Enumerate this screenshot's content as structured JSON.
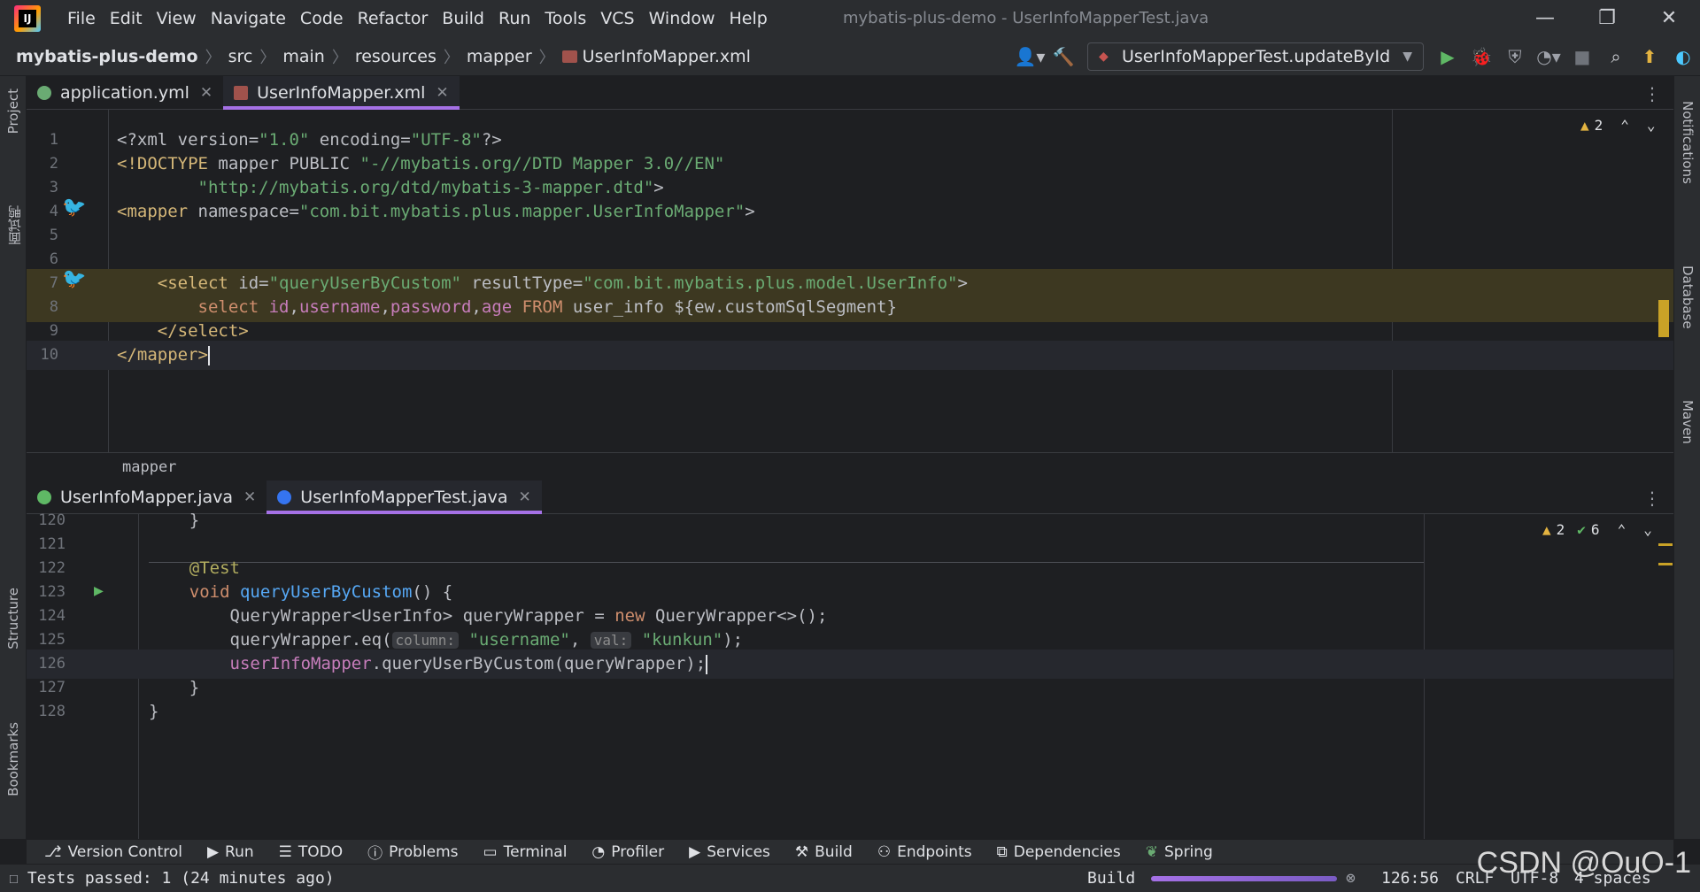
{
  "window": {
    "title": "mybatis-plus-demo - UserInfoMapperTest.java",
    "logo_text": "IJ",
    "menu": [
      "File",
      "Edit",
      "View",
      "Navigate",
      "Code",
      "Refactor",
      "Build",
      "Run",
      "Tools",
      "VCS",
      "Window",
      "Help"
    ],
    "controls": {
      "minimize": "—",
      "restore": "❐",
      "close": "✕"
    }
  },
  "breadcrumbs": [
    "mybatis-plus-demo",
    "src",
    "main",
    "resources",
    "mapper",
    "UserInfoMapper.xml"
  ],
  "run_config": {
    "label": "UserInfoMapperTest.updateById"
  },
  "top_editor": {
    "tabs": [
      {
        "label": "application.yml",
        "active": false
      },
      {
        "label": "UserInfoMapper.xml",
        "active": true
      }
    ],
    "warnings": "2",
    "breadcrumb": "mapper",
    "lines": [
      {
        "n": "1",
        "parts": [
          [
            "t-plain",
            "<?xml version="
          ],
          [
            "t-str",
            "\"1.0\""
          ],
          [
            "t-plain",
            " encoding="
          ],
          [
            "t-str",
            "\"UTF-8\""
          ],
          [
            "t-plain",
            "?>"
          ]
        ]
      },
      {
        "n": "2",
        "parts": [
          [
            "t-tag",
            "<!DOCTYPE"
          ],
          [
            "t-plain",
            " mapper PUBLIC "
          ],
          [
            "t-str",
            "\"-//mybatis.org//DTD Mapper 3.0//EN\""
          ]
        ]
      },
      {
        "n": "3",
        "parts": [
          [
            "t-str",
            "        \"http://mybatis.org/dtd/mybatis-3-mapper.dtd\""
          ],
          [
            "t-plain",
            ">"
          ]
        ]
      },
      {
        "n": "4",
        "parts": [
          [
            "t-tag",
            "<mapper"
          ],
          [
            "t-plain",
            " namespace="
          ],
          [
            "t-str",
            "\"com.bit.mybatis.plus.mapper.UserInfoMapper\""
          ],
          [
            "t-plain",
            ">"
          ]
        ]
      },
      {
        "n": "5",
        "parts": []
      },
      {
        "n": "6",
        "parts": []
      },
      {
        "n": "7",
        "parts": [
          [
            "t-tag",
            "    <select"
          ],
          [
            "t-plain",
            " id="
          ],
          [
            "t-str",
            "\"queryUserByCustom\""
          ],
          [
            "t-plain",
            " resultType="
          ],
          [
            "t-str",
            "\"com.bit.mybatis.plus.model.UserInfo\""
          ],
          [
            "t-plain",
            ">"
          ]
        ]
      },
      {
        "n": "8",
        "parts": [
          [
            "t-kw",
            "        select "
          ],
          [
            "t-fld",
            "id"
          ],
          [
            "t-plain",
            ","
          ],
          [
            "t-fld",
            "username"
          ],
          [
            "t-plain",
            ","
          ],
          [
            "t-fld",
            "password"
          ],
          [
            "t-plain",
            ","
          ],
          [
            "t-fld",
            "age"
          ],
          [
            "t-kw",
            " FROM "
          ],
          [
            "t-plain",
            "user_info ${ew.customSqlSegment}"
          ]
        ]
      },
      {
        "n": "9",
        "parts": [
          [
            "t-tag",
            "    </select>"
          ]
        ]
      },
      {
        "n": "10",
        "parts": [
          [
            "t-tag",
            "</mapper>"
          ]
        ]
      }
    ]
  },
  "bottom_editor": {
    "tabs": [
      {
        "label": "UserInfoMapper.java",
        "active": false
      },
      {
        "label": "UserInfoMapperTest.java",
        "active": true
      }
    ],
    "warnings": "2",
    "checks": "6",
    "lines": [
      {
        "n": "120",
        "parts": [
          [
            "t-plain",
            "    }"
          ]
        ]
      },
      {
        "n": "121",
        "parts": []
      },
      {
        "n": "122",
        "parts": [
          [
            "t-ann",
            "    @Test"
          ]
        ]
      },
      {
        "n": "123",
        "parts": [
          [
            "t-kw",
            "    void "
          ],
          [
            "t-fn",
            "queryUserByCustom"
          ],
          [
            "t-plain",
            "() {"
          ]
        ]
      },
      {
        "n": "124",
        "parts": [
          [
            "t-plain",
            "        QueryWrapper<UserInfo> queryWrapper = "
          ],
          [
            "t-kw",
            "new"
          ],
          [
            "t-plain",
            " QueryWrapper<>();"
          ]
        ]
      },
      {
        "n": "125",
        "parts": [
          [
            "t-plain",
            "        queryWrapper.eq("
          ],
          [
            "t-hint",
            "column:"
          ],
          [
            "t-plain",
            " "
          ],
          [
            "t-str",
            "\"username\""
          ],
          [
            "t-plain",
            ", "
          ],
          [
            "t-hint",
            "val:"
          ],
          [
            "t-plain",
            " "
          ],
          [
            "t-str",
            "\"kunkun\""
          ],
          [
            "t-plain",
            ");"
          ]
        ]
      },
      {
        "n": "126",
        "parts": [
          [
            "t-fld",
            "        userInfoMapper"
          ],
          [
            "t-plain",
            ".queryUserByCustom(queryWrapper);"
          ]
        ]
      },
      {
        "n": "127",
        "parts": [
          [
            "t-plain",
            "    }"
          ]
        ]
      },
      {
        "n": "128",
        "parts": [
          [
            "t-plain",
            "}"
          ]
        ]
      }
    ]
  },
  "left_stripe": [
    "Project",
    "面试鸭",
    "Structure",
    "Bookmarks"
  ],
  "right_stripe": [
    "Notifications",
    "Database",
    "Maven"
  ],
  "tool_windows": [
    "Version Control",
    "Run",
    "TODO",
    "Problems",
    "Terminal",
    "Profiler",
    "Services",
    "Build",
    "Endpoints",
    "Dependencies",
    "Spring"
  ],
  "status": {
    "message": "Tests passed: 1 (24 minutes ago)",
    "build_label": "Build",
    "position": "126:56",
    "line_sep": "CRLF",
    "encoding": "UTF-8",
    "indent": "4 spaces"
  },
  "watermark": "CSDN @OuO-1",
  "colors": {
    "accent": "#a571e6",
    "background": "#1e1f22",
    "panel": "#2b2d30"
  }
}
